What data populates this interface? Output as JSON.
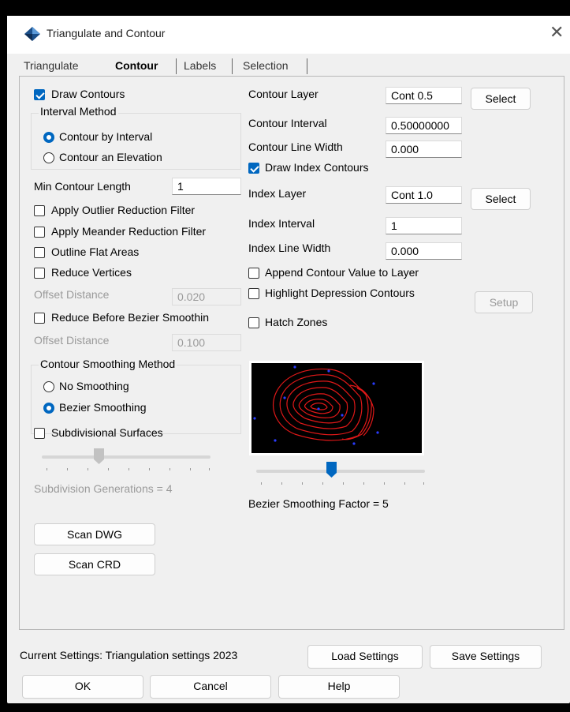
{
  "window": {
    "title": "Triangulate and Contour",
    "close_glyph": "✕"
  },
  "tabs": [
    {
      "label": "Triangulate",
      "active": false
    },
    {
      "label": "Contour",
      "active": true
    },
    {
      "label": "Labels",
      "active": false
    },
    {
      "label": "Selection",
      "active": false
    }
  ],
  "left": {
    "draw_contours": {
      "label": "Draw Contours",
      "checked": true
    },
    "interval_method": {
      "title": "Interval Method",
      "options": [
        {
          "label": "Contour by Interval",
          "selected": true
        },
        {
          "label": "Contour an Elevation",
          "selected": false
        }
      ]
    },
    "min_contour_length": {
      "label": "Min Contour Length",
      "value": "1"
    },
    "outlier_filter": {
      "label": "Apply Outlier Reduction Filter",
      "checked": false
    },
    "meander_filter": {
      "label": "Apply Meander Reduction Filter",
      "checked": false
    },
    "outline_flat": {
      "label": "Outline Flat Areas",
      "checked": false
    },
    "reduce_vertices": {
      "label": "Reduce Vertices",
      "checked": false
    },
    "offset_distance_1": {
      "label": "Offset Distance",
      "value": "0.020"
    },
    "reduce_before_bezier": {
      "label": "Reduce Before Bezier Smoothin",
      "checked": false
    },
    "offset_distance_2": {
      "label": "Offset Distance",
      "value": "0.100"
    },
    "smoothing": {
      "title": "Contour Smoothing Method",
      "options": [
        {
          "label": "No Smoothing",
          "selected": false
        },
        {
          "label": "Bezier Smoothing",
          "selected": true
        }
      ]
    },
    "subdivisional": {
      "label": "Subdivisional Surfaces",
      "checked": false
    },
    "subdivision_slider": {
      "label": "Subdivision Generations = 4",
      "value": 4
    },
    "scan_dwg": "Scan DWG",
    "scan_crd": "Scan CRD"
  },
  "right": {
    "contour_layer": {
      "label": "Contour Layer",
      "value": "Cont 0.5",
      "button": "Select"
    },
    "contour_interval": {
      "label": "Contour Interval",
      "value": "0.50000000"
    },
    "contour_line_width": {
      "label": "Contour Line Width",
      "value": "0.000"
    },
    "draw_index": {
      "label": "Draw Index Contours",
      "checked": true
    },
    "index_layer": {
      "label": "Index Layer",
      "value": "Cont 1.0",
      "button": "Select"
    },
    "index_interval": {
      "label": "Index Interval",
      "value": "1"
    },
    "index_line_width": {
      "label": "Index Line Width",
      "value": "0.000"
    },
    "append_value": {
      "label": "Append Contour Value to Layer",
      "checked": false
    },
    "highlight_depression": {
      "label": "Highlight Depression Contours",
      "checked": false,
      "button": "Setup"
    },
    "hatch_zones": {
      "label": "Hatch Zones",
      "checked": false
    },
    "bezier_slider": {
      "label": "Bezier Smoothing Factor = 5",
      "value": 5
    }
  },
  "footer": {
    "current_settings": "Current Settings: Triangulation settings 2023",
    "load": "Load Settings",
    "save": "Save Settings",
    "ok": "OK",
    "cancel": "Cancel",
    "help": "Help"
  },
  "colors": {
    "accent": "#0067c0",
    "contour_line": "#e01818",
    "point": "#2a3cff"
  }
}
